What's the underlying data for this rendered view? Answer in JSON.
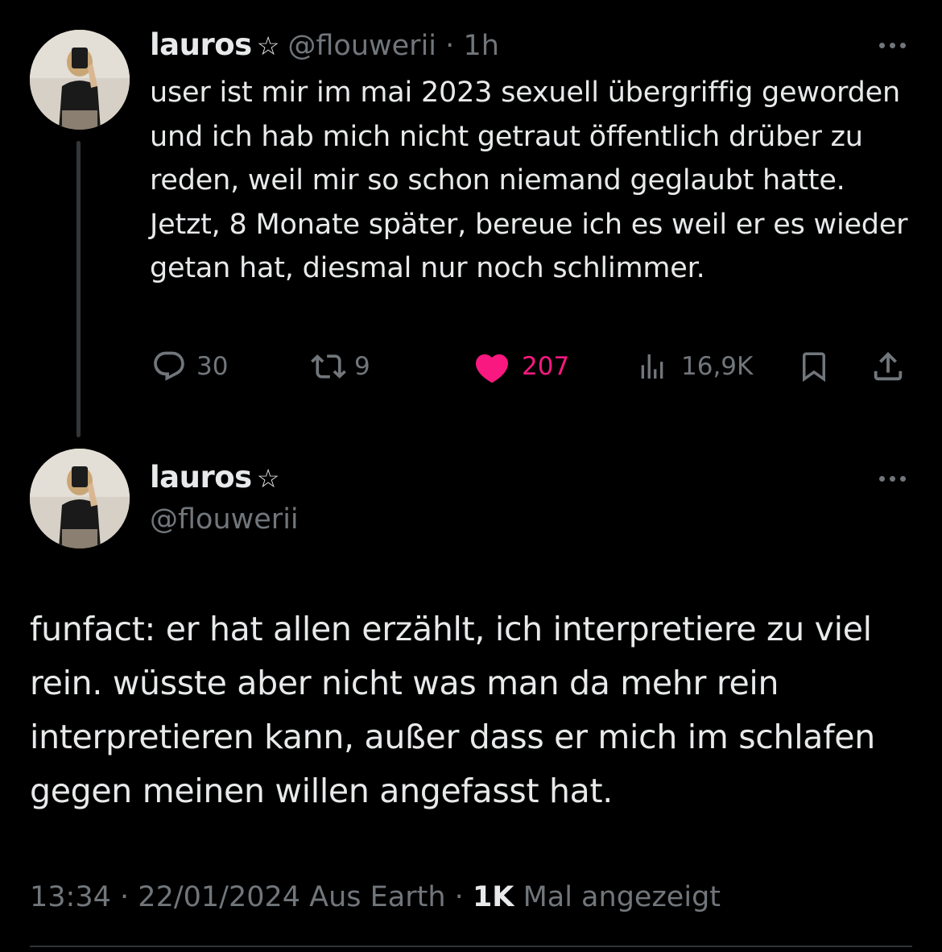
{
  "tweet1": {
    "display_name": "lauros",
    "name_badge": "☆",
    "handle": "@flouwerii",
    "separator": "·",
    "time": "1h",
    "text": "user ist mir im mai 2023 sexuell übergriffig geworden und ich hab mich nicht getraut öffentlich drüber zu reden, weil mir so schon niemand geglaubt hatte. Jetzt, 8 Monate später, bereue ich es weil er es wieder getan hat, diesmal nur noch schlimmer.",
    "actions": {
      "replies": "30",
      "reposts": "9",
      "likes": "207",
      "views": "16,9K"
    },
    "liked": true
  },
  "tweet2": {
    "display_name": "lauros",
    "name_badge": "☆",
    "handle": "@flouwerii",
    "text": "funfact: er hat allen erzählt, ich interpretiere zu viel rein. wüsste aber nicht was man da mehr rein interpretieren kann, außer dass er mich im schlafen gegen meinen willen angefasst hat.",
    "meta": {
      "time": "13:34",
      "separator": "·",
      "date": "22/01/2024",
      "source": "Aus Earth",
      "view_count": "1K",
      "view_label": "Mal angezeigt"
    }
  },
  "colors": {
    "background": "#000000",
    "text": "#e7e9ea",
    "muted": "#71767b",
    "like": "#f91880",
    "line": "#333639"
  },
  "icons": [
    "avatar",
    "star-icon",
    "more-icon",
    "reply-icon",
    "repost-icon",
    "heart-icon",
    "views-icon",
    "bookmark-icon",
    "share-icon"
  ]
}
